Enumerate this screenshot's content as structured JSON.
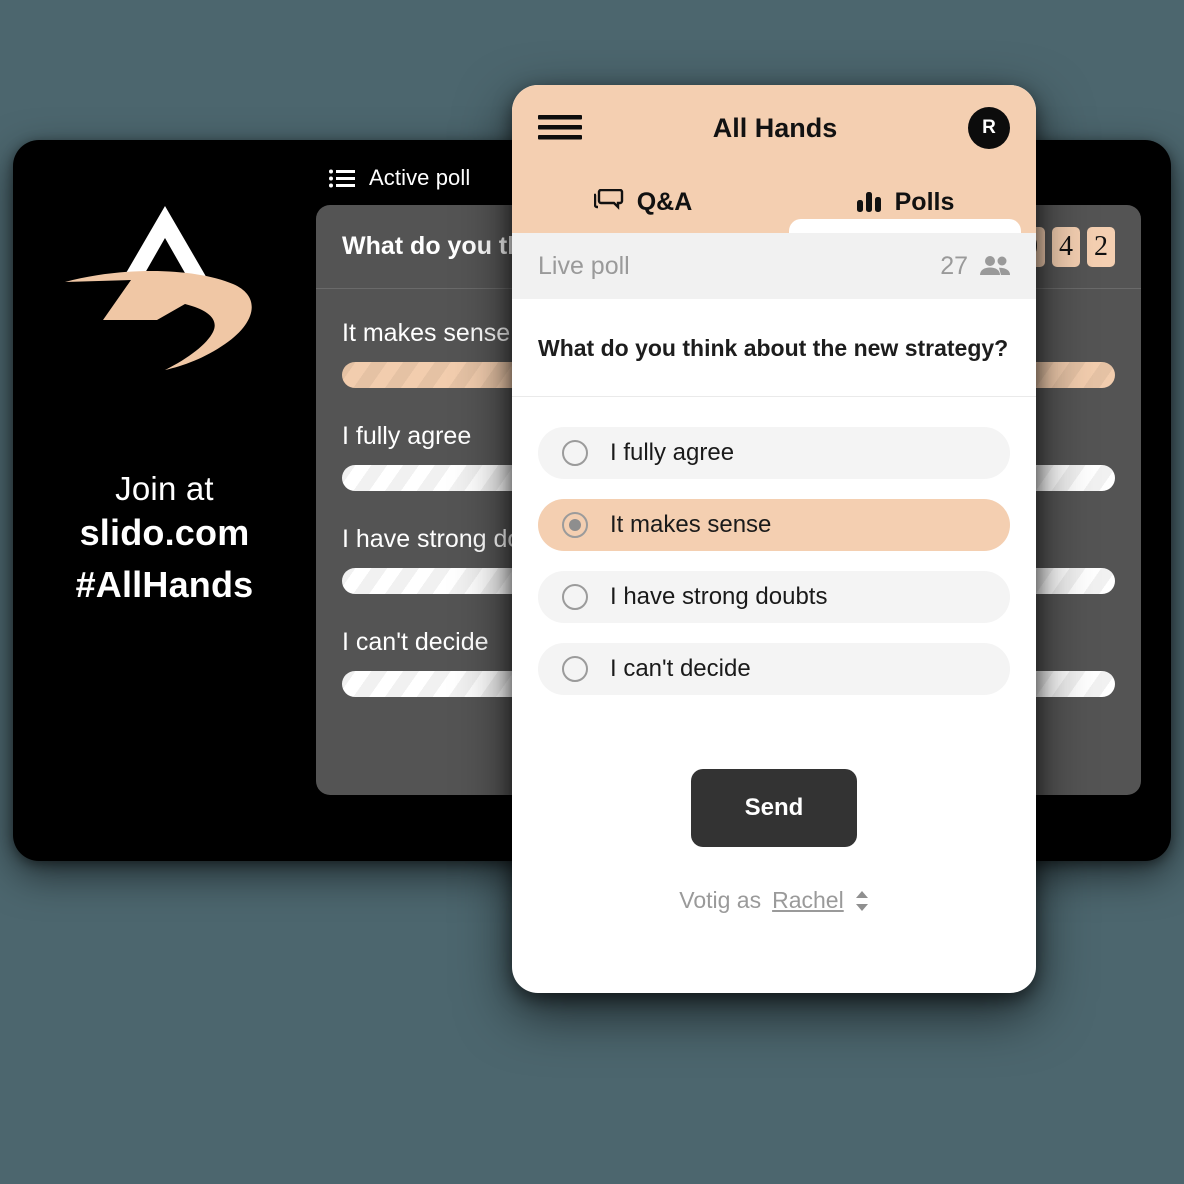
{
  "theme": {
    "page_background": "#4c666e",
    "accent": "#f4cfb1",
    "dark_card": "#000000",
    "results_panel": "#545454",
    "send_button": "#333333"
  },
  "back_card": {
    "branding": {
      "logo_name": "slido-a-swoosh-logo",
      "join_text": "Join at",
      "url": "slido.com",
      "hashtag": "#AllHands"
    },
    "active_poll_header": {
      "icon": "list-icon",
      "label": "Active poll"
    },
    "results": {
      "question": "What do you think about the new strategy?",
      "vote_code_digits": [
        "0",
        "4",
        "2"
      ],
      "rows": [
        {
          "label": "It makes sense",
          "accent": true,
          "width_pct": 100
        },
        {
          "label": "I fully agree",
          "accent": false,
          "width_pct": 100
        },
        {
          "label": "I have strong doubts",
          "accent": false,
          "width_pct": 100
        },
        {
          "label": "I can't decide",
          "accent": false,
          "width_pct": 100
        }
      ]
    }
  },
  "phone": {
    "topbar": {
      "menu_icon": "hamburger-menu-icon",
      "title": "All Hands",
      "avatar_initial": "R"
    },
    "tabs": [
      {
        "id": "qa",
        "label": "Q&A",
        "icon": "speech-bubbles-icon",
        "active": false
      },
      {
        "id": "polls",
        "label": "Polls",
        "icon": "bar-chart-icon",
        "active": true
      }
    ],
    "live_poll_bar": {
      "label": "Live poll",
      "participant_count": "27",
      "participants_icon": "people-group-icon"
    },
    "poll": {
      "question": "What do you think about the new strategy?",
      "options": [
        {
          "label": "I fully agree",
          "selected": false
        },
        {
          "label": "It makes sense",
          "selected": true
        },
        {
          "label": "I have strong doubts",
          "selected": false
        },
        {
          "label": "I can't decide",
          "selected": false
        }
      ]
    },
    "send_label": "Send",
    "voting_as": {
      "prefix": "Votig as",
      "name": "Rachel",
      "chevron_icon": "up-down-chevron-icon"
    }
  }
}
